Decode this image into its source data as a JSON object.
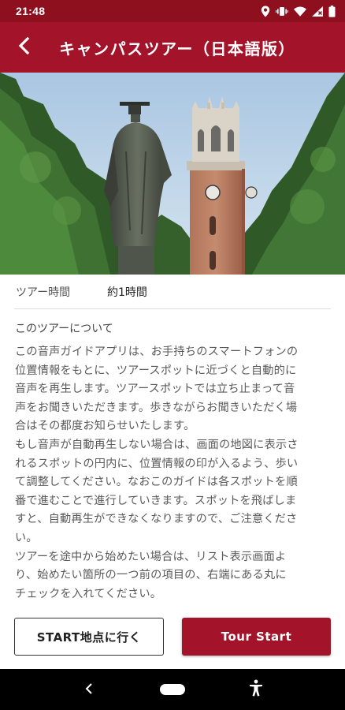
{
  "status_bar": {
    "time": "21:48",
    "icons": [
      "location-icon",
      "vibrate-icon",
      "wifi-icon",
      "signal-icon",
      "battery-icon"
    ]
  },
  "app_bar": {
    "title": "キャンパスツアー（日本語版）",
    "back_icon": "chevron-left-icon"
  },
  "hero": {
    "description_icon": "campus-photo"
  },
  "tour_info": {
    "time_label": "ツアー時間",
    "time_value": "約1時間"
  },
  "about": {
    "title": "このツアーについて",
    "text": "この音声ガイドアプリは、お手持ちのスマートフォンの\n位置情報をもとに、ツアースポットに近づくと自動的に\n音声を再生します。ツアースポットでは立ち止まって音\n声をお聞きいただきます。歩きながらお聞きいただく場\n合はその都度お知らせいたします。\nもし音声が自動再生しない場合は、画面の地図に表示さ\nれるスポットの円内に、位置情報の印が入るよう、歩い\nて調整してください。なおこのガイドは各スポットを順\n番で進むことで進行していきます。スポットを飛ばしま\nすと、自動再生ができなくなりますので、ご注意くださ\nい。\nツアーを途中から始めたい場合は、リスト表示画面よ\nり、始めたい箇所の一つ前の項目の、右端にある丸に\nチェックを入れてください。"
  },
  "buttons": {
    "start_point_label": "START地点に行く",
    "tour_start_label": "Tour Start"
  },
  "colors": {
    "brand": "#a3142a",
    "status_bar": "#8e0f1d"
  },
  "nav_bar": {
    "icons": [
      "back-nav-icon",
      "home-pill-icon",
      "accessibility-icon"
    ]
  }
}
